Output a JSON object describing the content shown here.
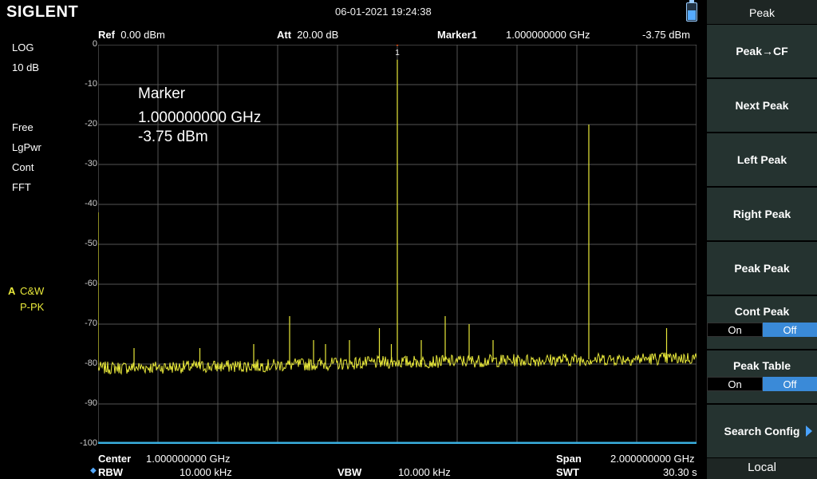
{
  "header": {
    "brand": "SIGLENT",
    "datetime": "06-01-2021   19:24:38",
    "ref_label": "Ref",
    "ref_value": "0.00 dBm",
    "att_label": "Att",
    "att_value": "20.00 dB",
    "marker_label": "Marker1",
    "marker_freq": "1.000000000 GHz",
    "marker_amp": "-3.75 dBm"
  },
  "left_info": {
    "scale_type": "LOG",
    "scale_div": "10 dB",
    "trig": "Free",
    "avg_type": "LgPwr",
    "sweep_mode": "Cont",
    "sweep_type": "FFT",
    "trace_id": "A",
    "trace_mode": "C&W",
    "detector": "P-PK"
  },
  "marker_box": {
    "title": "Marker",
    "freq": "1.000000000 GHz",
    "amp": "-3.75 dBm"
  },
  "yaxis_labels": [
    "0",
    "-10",
    "-20",
    "-30",
    "-40",
    "-50",
    "-60",
    "-70",
    "-80",
    "-90",
    "-100"
  ],
  "footer": {
    "center_label": "Center",
    "center_value": "1.000000000 GHz",
    "span_label": "Span",
    "span_value": "2.000000000 GHz",
    "rbw_label": "RBW",
    "rbw_value": "10.000 kHz",
    "vbw_label": "VBW",
    "vbw_value": "10.000 kHz",
    "swt_label": "SWT",
    "swt_value": "30.30 s"
  },
  "softkeys": {
    "title": "Peak",
    "peak_cf": "Peak→CF",
    "next_peak": "Next Peak",
    "left_peak": "Left Peak",
    "right_peak": "Right Peak",
    "peak_peak": "Peak Peak",
    "cont_peak": "Cont Peak",
    "cont_peak_on": "On",
    "cont_peak_off": "Off",
    "peak_table": "Peak Table",
    "peak_table_on": "On",
    "peak_table_off": "Off",
    "search_config": "Search Config",
    "local": "Local"
  },
  "colors": {
    "trace": "#e8e83a",
    "marker": "#ff5a1a",
    "grid": "#555555",
    "accent": "#3a8ad8"
  },
  "chart_data": {
    "type": "line",
    "xlabel": "",
    "ylabel": "",
    "xlim": [
      0.0,
      2.0
    ],
    "ylim": [
      -100,
      0
    ],
    "x_unit": "GHz",
    "y_unit": "dBm",
    "noise_floor": [
      [
        0.0,
        -81
      ],
      [
        0.5,
        -80.5
      ],
      [
        1.0,
        -79.5
      ],
      [
        1.5,
        -79
      ],
      [
        2.0,
        -78.5
      ]
    ],
    "peaks": [
      {
        "x": 0.0,
        "y": -42
      },
      {
        "x": 0.12,
        "y": -76
      },
      {
        "x": 0.34,
        "y": -76
      },
      {
        "x": 0.52,
        "y": -75
      },
      {
        "x": 0.64,
        "y": -68
      },
      {
        "x": 0.72,
        "y": -74
      },
      {
        "x": 0.76,
        "y": -75
      },
      {
        "x": 0.84,
        "y": -74
      },
      {
        "x": 0.94,
        "y": -71
      },
      {
        "x": 0.98,
        "y": -75
      },
      {
        "x": 1.0,
        "y": -3.75
      },
      {
        "x": 1.08,
        "y": -74
      },
      {
        "x": 1.16,
        "y": -68
      },
      {
        "x": 1.24,
        "y": -70
      },
      {
        "x": 1.32,
        "y": -74
      },
      {
        "x": 1.64,
        "y": -20
      },
      {
        "x": 1.9,
        "y": -71
      }
    ],
    "marker": {
      "label": "1",
      "x": 1.0,
      "y": -3.75
    }
  }
}
